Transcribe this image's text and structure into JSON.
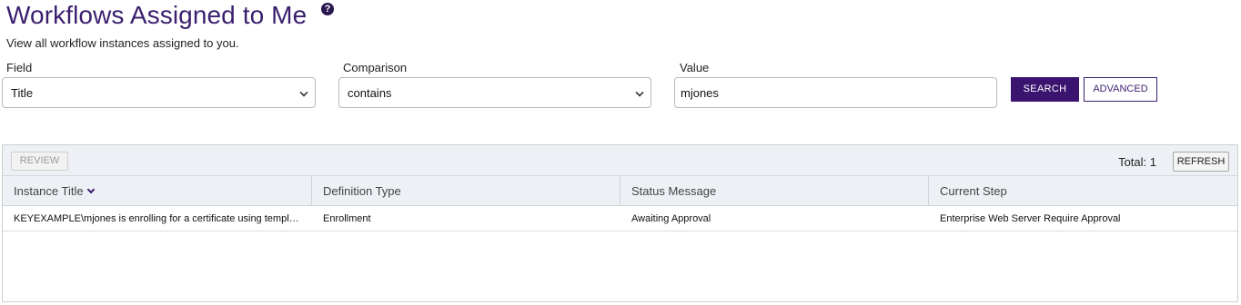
{
  "page": {
    "title": "Workflows Assigned to Me",
    "help_icon": "?",
    "subtitle": "View all workflow instances assigned to you."
  },
  "filter": {
    "field_label": "Field",
    "field_value": "Title",
    "comparison_label": "Comparison",
    "comparison_value": "contains",
    "value_label": "Value",
    "value_value": "mjones",
    "search_label": "SEARCH",
    "advanced_label": "ADVANCED"
  },
  "grid": {
    "review_label": "REVIEW",
    "total_label": "Total: 1",
    "refresh_label": "REFRESH",
    "columns": [
      "Instance Title",
      "Definition Type",
      "Status Message",
      "Current Step"
    ],
    "sort_icon": "chevron-down-icon",
    "rows": [
      [
        "KEYEXAMPLE\\mjones is enrolling for a certificate using template Enterprise Web Server Require Approval",
        "Enrollment",
        "Awaiting Approval",
        "Enterprise Web Server Require Approval"
      ]
    ]
  },
  "colors": {
    "accent": "#3b1470",
    "title": "#3b1f6e",
    "toolbar_bg": "#edf0f5"
  }
}
